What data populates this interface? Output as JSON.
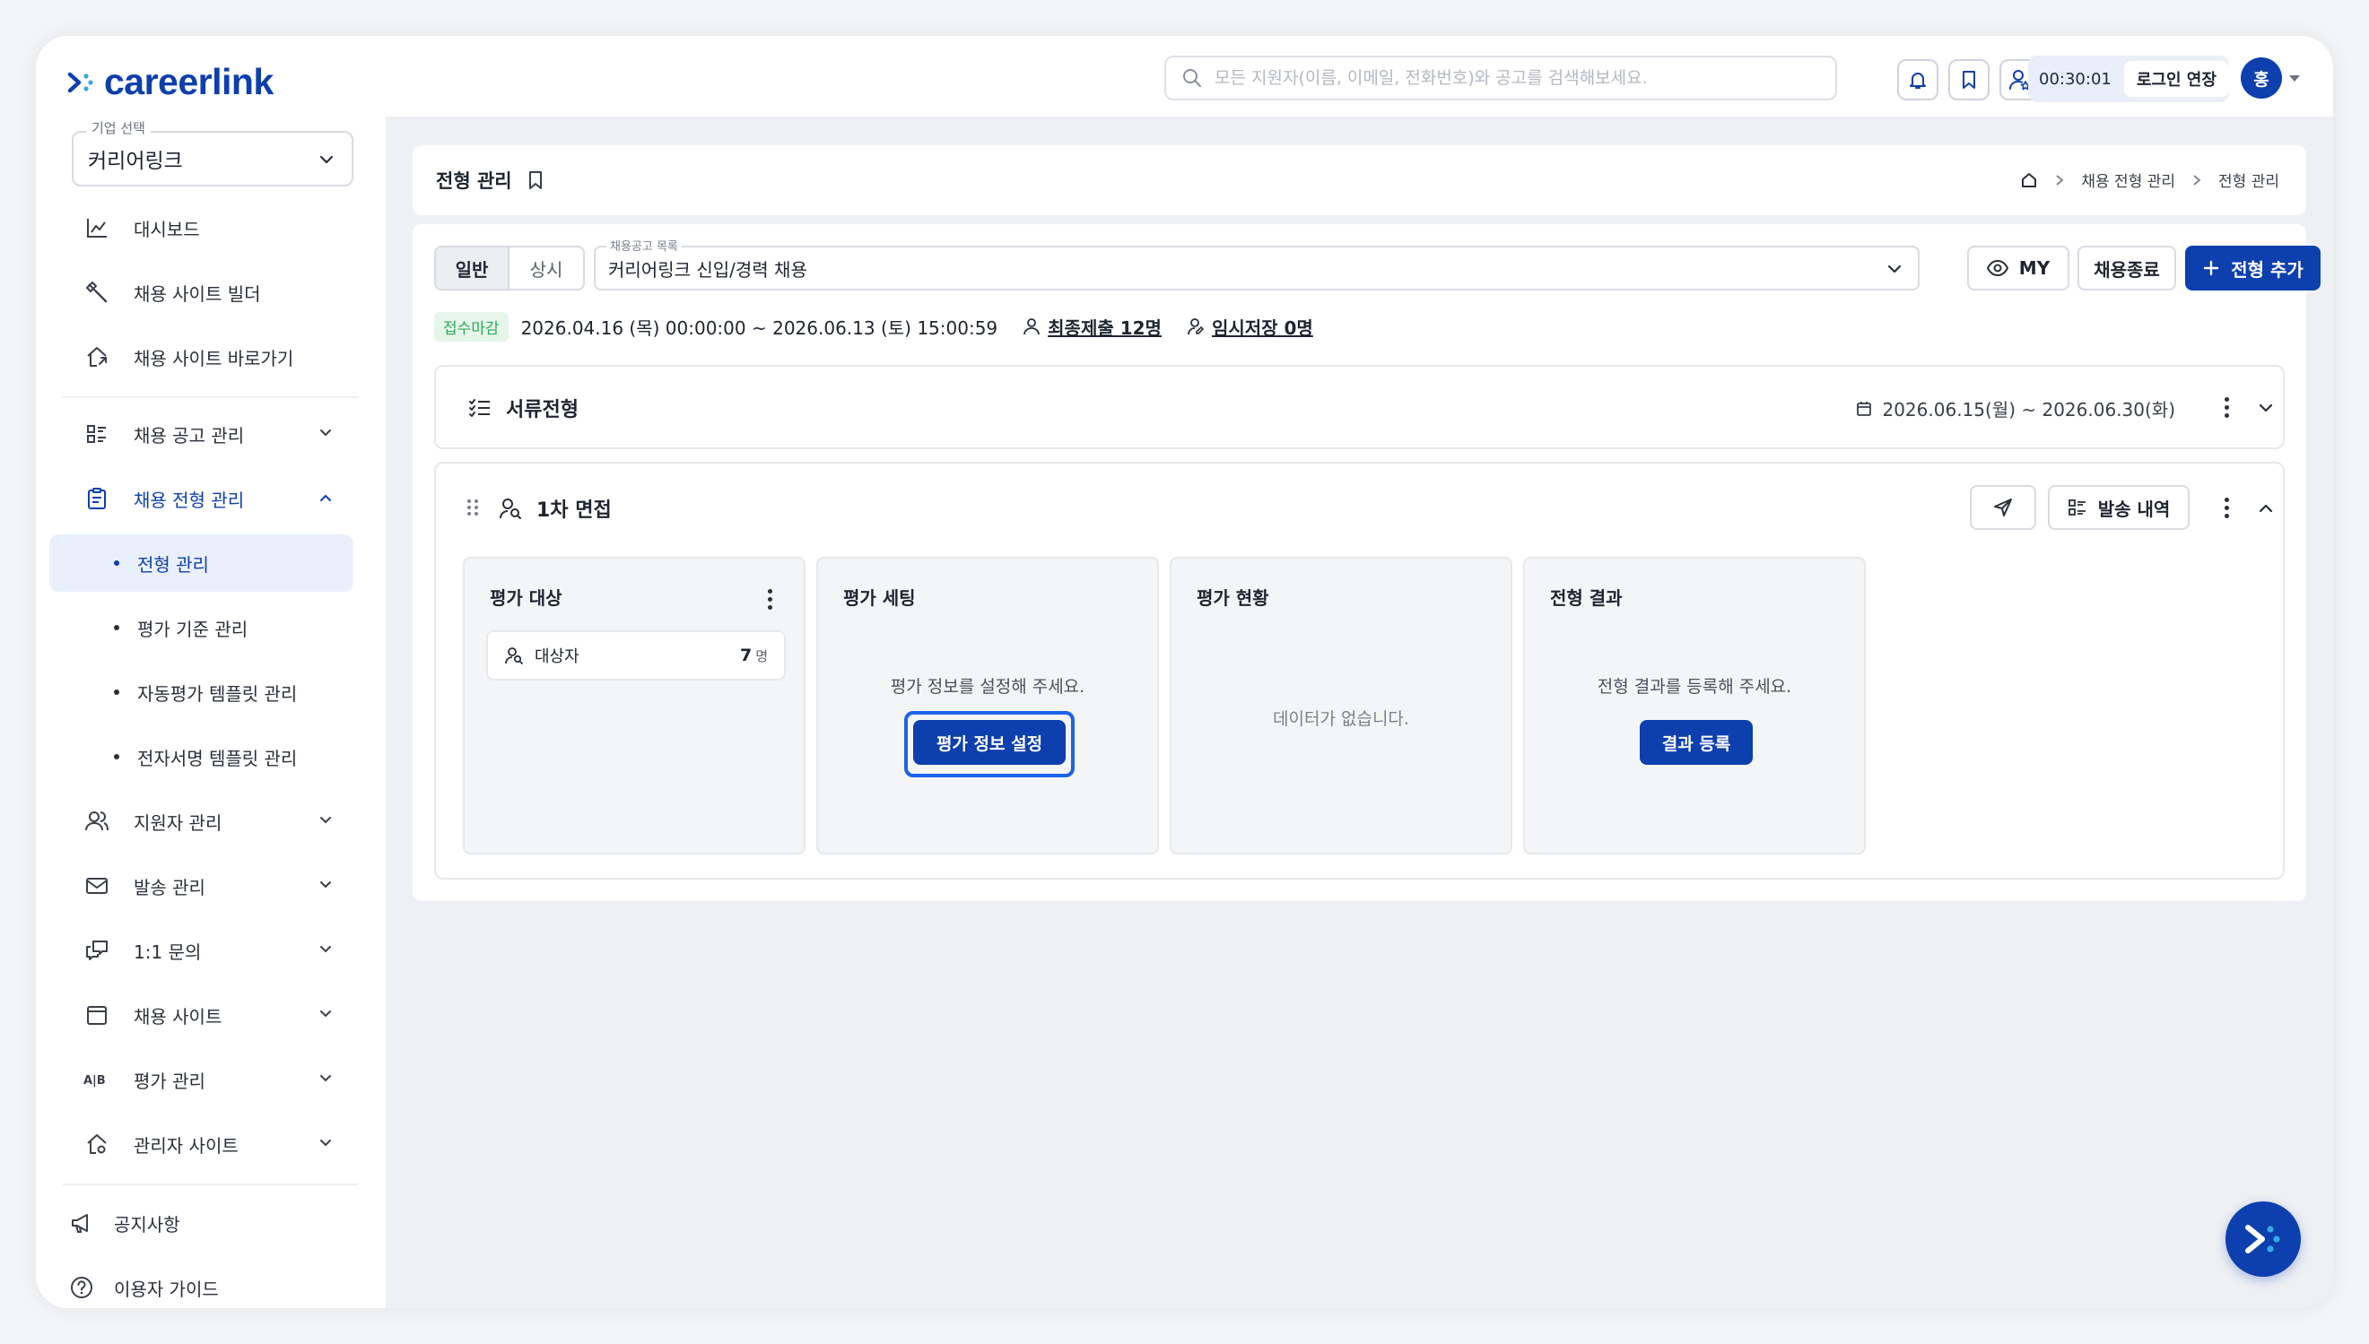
{
  "header": {
    "logo_text": "careerlink",
    "search_placeholder": "모든 지원자(이름, 이메일, 전화번호)와 공고를 검색해보세요.",
    "icons": [
      "bell-icon",
      "bookmark-icon",
      "user-star-icon"
    ],
    "timer": "00:30:01",
    "extend_label": "로그인 연장",
    "avatar_initial": "홍"
  },
  "sidebar": {
    "company_legend": "기업 선택",
    "company_value": "커리어링크",
    "items": [
      {
        "label": "대시보드",
        "icon": "chart-icon"
      },
      {
        "label": "채용 사이트 빌더",
        "icon": "tools-icon"
      },
      {
        "label": "채용 사이트 바로가기",
        "icon": "home-link-icon"
      },
      {
        "label": "채용 공고 관리",
        "icon": "list-icon"
      },
      {
        "label": "채용 전형 관리",
        "icon": "clipboard-icon"
      },
      {
        "label": "지원자 관리",
        "icon": "users-icon"
      },
      {
        "label": "발송 관리",
        "icon": "mail-icon"
      },
      {
        "label": "1:1 문의",
        "icon": "chat-icon"
      },
      {
        "label": "채용 사이트",
        "icon": "window-icon"
      },
      {
        "label": "평가 관리",
        "icon": "ab-icon"
      },
      {
        "label": "관리자 사이트",
        "icon": "admin-home-icon"
      }
    ],
    "sub_items": [
      "전형 관리",
      "평가 기준 관리",
      "자동평가 템플릿 관리",
      "전자서명 템플릿 관리"
    ],
    "footer": [
      {
        "label": "공지사항",
        "icon": "megaphone-icon"
      },
      {
        "label": "이용자 가이드",
        "icon": "help-icon"
      }
    ]
  },
  "page": {
    "title": "전형 관리",
    "breadcrumb": [
      "채용 전형 관리",
      "전형 관리"
    ]
  },
  "toolbar": {
    "tabs": [
      "일반",
      "상시"
    ],
    "posting_legend": "채용공고 목록",
    "posting_value": "커리어링크 신입/경력 채용",
    "my_label": "MY",
    "close_label": "채용종료",
    "add_label": "전형 추가"
  },
  "info": {
    "status": "접수마감",
    "period": "2026.04.16 (목) 00:00:00 ~ 2026.06.13 (토) 15:00:59",
    "final_submit": "최종제출 12명",
    "temp_save": "임시저장 0명"
  },
  "stages": {
    "document": {
      "title": "서류전형",
      "date": "2026.06.15(월) ~ 2026.06.30(화)"
    },
    "interview": {
      "title": "1차 면접",
      "send_history": "발송 내역",
      "panels": {
        "target": {
          "title": "평가 대상",
          "chip_label": "대상자",
          "count": "7",
          "unit": "명"
        },
        "setting": {
          "title": "평가 세팅",
          "message": "평가 정보를 설정해 주세요.",
          "button": "평가 정보 설정"
        },
        "status": {
          "title": "평가 현황",
          "message": "데이터가 없습니다."
        },
        "result": {
          "title": "전형 결과",
          "message": "전형 결과를 등록해 주세요.",
          "button": "결과 등록"
        }
      }
    }
  },
  "colors": {
    "brand": "#0d3fae",
    "focus": "#1b63e8",
    "status_closed": "#2fa85a"
  }
}
